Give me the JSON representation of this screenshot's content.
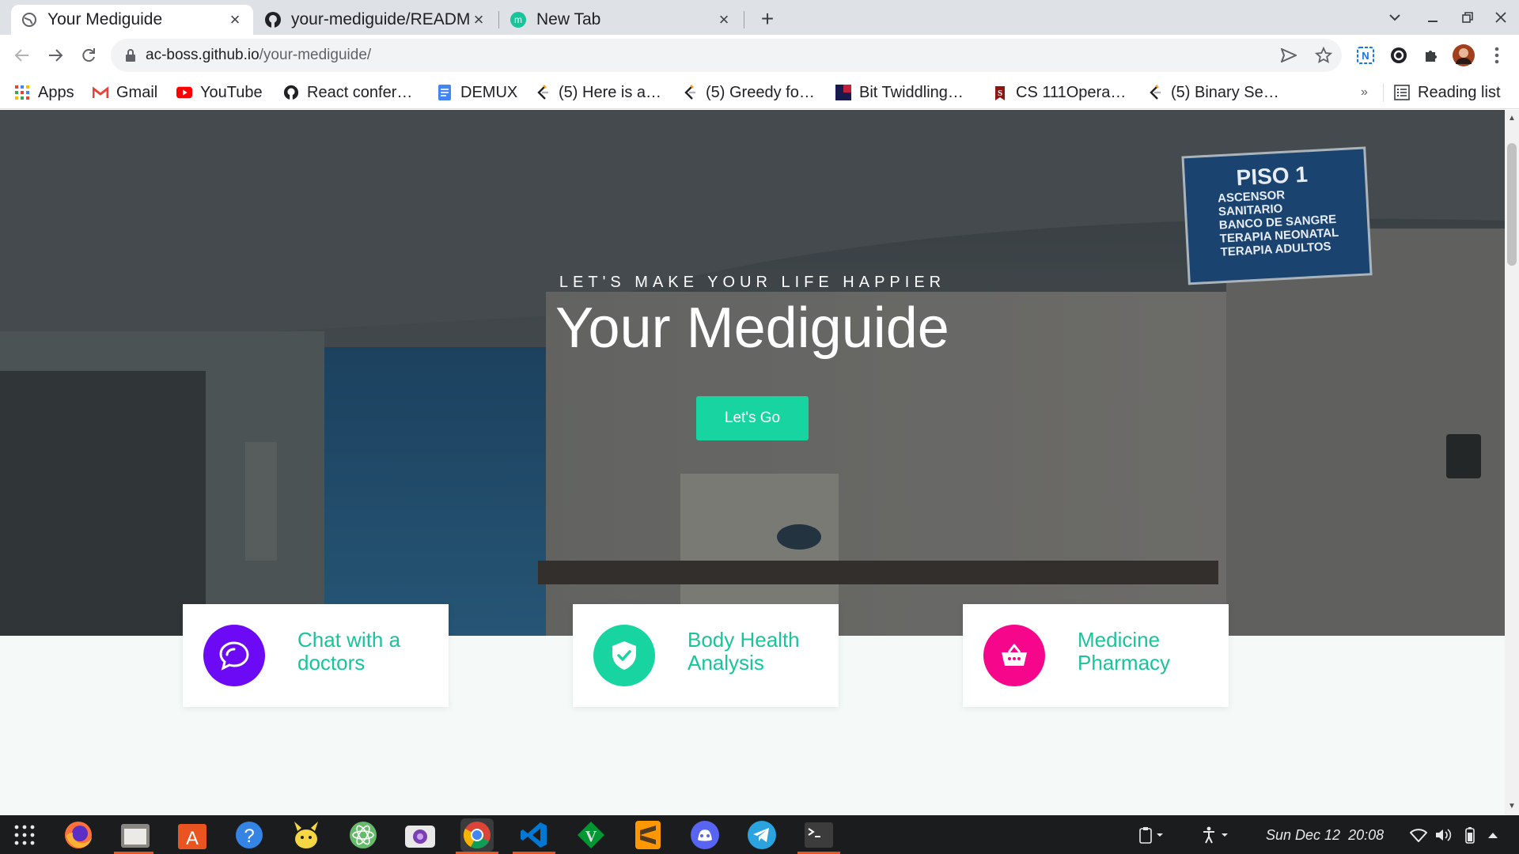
{
  "browser": {
    "tabs": [
      {
        "title": "Your Mediguide",
        "active": true,
        "icon": "globe-icon"
      },
      {
        "title": "your-mediguide/READM",
        "active": false,
        "icon": "github-icon"
      },
      {
        "title": "New Tab",
        "active": false,
        "icon": "mediguide-m-icon"
      }
    ],
    "url_host": "ac-boss.github.io",
    "url_path": "/your-mediguide/",
    "bookmarks": [
      {
        "label": "Apps",
        "icon": "apps-grid-icon"
      },
      {
        "label": "Gmail",
        "icon": "gmail-icon"
      },
      {
        "label": "YouTube",
        "icon": "youtube-icon"
      },
      {
        "label": "React confer…",
        "icon": "github-icon"
      },
      {
        "label": "DEMUX",
        "icon": "docs-icon"
      },
      {
        "label": "(5) Here is a…",
        "icon": "leetcode-icon"
      },
      {
        "label": "(5) Greedy fo…",
        "icon": "leetcode-icon"
      },
      {
        "label": "Bit Twiddling…",
        "icon": "bit-icon"
      },
      {
        "label": "CS 111Opera…",
        "icon": "stanford-icon"
      },
      {
        "label": "(5) Binary Se…",
        "icon": "leetcode-icon"
      }
    ],
    "bookmarks_overflow": "»",
    "reading_list": "Reading list"
  },
  "hero": {
    "subtitle": "LET'S MAKE YOUR LIFE HAPPIER",
    "title": "Your Mediguide",
    "button": "Let's Go",
    "sign_text": [
      "PISO 1",
      "ASCENSOR",
      "SANITARIO",
      "BANCO DE SANGRE",
      "TERAPIA NEONATAL",
      "TERAPIA ADULTOS"
    ]
  },
  "features": [
    {
      "label": "Chat with a doctors",
      "icon": "chat-icon",
      "color": "#6d0af5"
    },
    {
      "label": "Body Health Analysis",
      "icon": "shield-check-icon",
      "color": "#18d4a0"
    },
    {
      "label": "Medicine Pharmacy",
      "icon": "basket-icon",
      "color": "#f5068a"
    }
  ],
  "accent": "#18c49a",
  "taskbar": {
    "clock": "Sun Dec 12  20:08",
    "apps": [
      "app-grid-icon",
      "firefox-icon",
      "files-icon",
      "software-center-icon",
      "help-icon",
      "pikachu-icon",
      "atom-icon",
      "camera-icon",
      "chrome-icon",
      "vscode-icon",
      "vim-icon",
      "sublime-icon",
      "discord-icon",
      "telegram-icon",
      "terminal-icon"
    ]
  }
}
